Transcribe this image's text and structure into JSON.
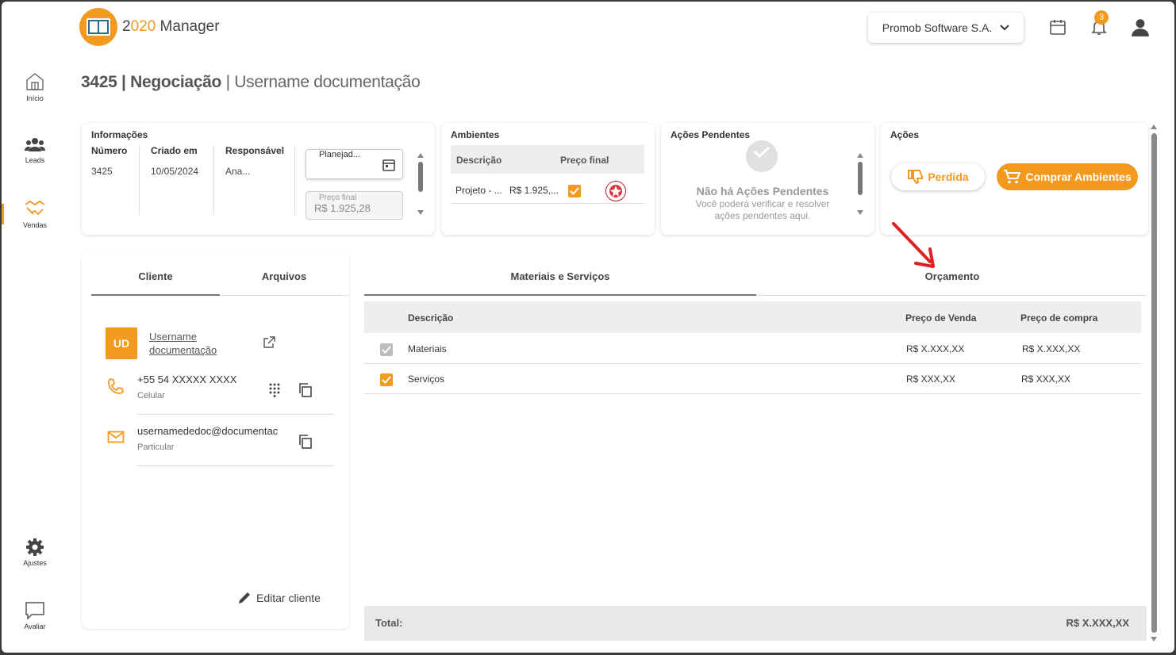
{
  "app": {
    "logo_left": "2",
    "logo_accent": "020",
    "logo_right": " Manager",
    "company": "Promob Software S.A.",
    "notifications": "3"
  },
  "sidebar": {
    "items": [
      {
        "label": "Início"
      },
      {
        "label": "Leads"
      },
      {
        "label": "Vendas"
      },
      {
        "label": "Ajustes"
      },
      {
        "label": "Avaliar"
      }
    ]
  },
  "page": {
    "number_part": "3425 | Negociação",
    "separator": " | ",
    "user": "Username documentação"
  },
  "info": {
    "title": "Informações",
    "numero_label": "Número",
    "numero": "3425",
    "criado_label": "Criado em",
    "criado": "10/05/2024",
    "responsavel_label": "Responsável",
    "responsavel": "Ana...",
    "status_value": "Planejad...",
    "preco_label": "Preço final",
    "preco_value": "R$ 1.925,28"
  },
  "ambientes": {
    "title": "Ambientes",
    "col_desc": "Descrição",
    "col_preco": "Preço final",
    "row_desc": "Projeto - ...",
    "row_preco": "R$ 1.925,..."
  },
  "pendentes": {
    "title": "Ações Pendentes",
    "empty_title": "Não há Ações Pendentes",
    "empty_l1": "Você poderá verificar e resolver",
    "empty_l2": "ações pendentes aqui."
  },
  "acoes": {
    "title": "Ações",
    "perdida": "Perdida",
    "comprar": "Comprar Ambientes"
  },
  "client": {
    "tab_cliente": "Cliente",
    "tab_arquivos": "Arquivos",
    "initials": "UD",
    "name_l1": "Username",
    "name_l2": "documentação",
    "phone": "+55 54 XXXXX XXXX",
    "phone_type": "Celular",
    "email": "usernamededoc@documentac",
    "email_type": "Particular",
    "edit": "Editar cliente"
  },
  "main": {
    "tab_materiais": "Materiais e Serviços",
    "tab_orcamento": "Orçamento",
    "col_desc": "Descrição",
    "col_venda": "Preço de Venda",
    "col_compra": "Preço de compra",
    "rows": [
      {
        "desc": "Materiais",
        "venda": "R$ X.XXX,XX",
        "compra": "R$ X.XXX,XX"
      },
      {
        "desc": "Serviços",
        "venda": "R$ XXX,XX",
        "compra": "R$ XXX,XX"
      }
    ],
    "total_label": "Total:",
    "total_value": "R$ X.XXX,XX"
  },
  "colors": {
    "accent": "#f39a1e",
    "annotation": "#e02020"
  }
}
